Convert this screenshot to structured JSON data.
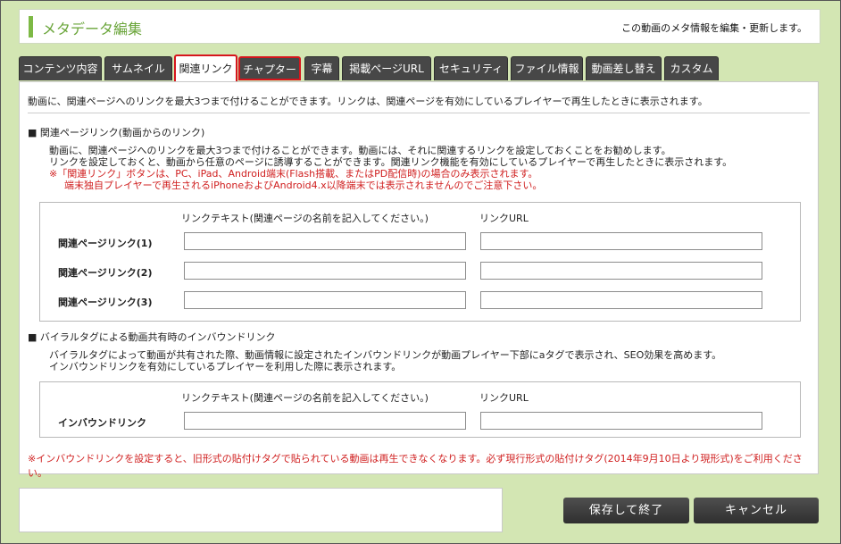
{
  "header": {
    "title": "メタデータ編集",
    "description": "この動画のメタ情報を編集・更新します。"
  },
  "tabs": [
    {
      "label": "コンテンツ内容"
    },
    {
      "label": "サムネイル"
    },
    {
      "label": "関連リンク"
    },
    {
      "label": "チャプター"
    },
    {
      "label": "字幕"
    },
    {
      "label": "掲載ページURL"
    },
    {
      "label": "セキュリティ"
    },
    {
      "label": "ファイル情報"
    },
    {
      "label": "動画差し替え"
    },
    {
      "label": "カスタム"
    }
  ],
  "panel": {
    "intro": "動画に、関連ページへのリンクを最大3つまで付けることができます。リンクは、関連ページを有効にしているプレイヤーで再生したときに表示されます。",
    "related": {
      "title": "■ 関連ページリンク(動画からのリンク)",
      "desc1": "動画に、関連ページへのリンクを最大3つまで付けることができます。動画には、それに関連するリンクを設定しておくことをお勧めします。",
      "desc2": "リンクを設定しておくと、動画から任意のページに誘導することができます。関連リンク機能を有効にしているプレイヤーで再生したときに表示されます。",
      "warn1": "※「関連リンク」ボタンは、PC、iPad、Android端末(Flash搭載、またはPD配信時)の場合のみ表示されます。",
      "warn2": "端末独自プレイヤーで再生されるiPhoneおよびAndroid4.x以降端末では表示されませんのでご注意下さい。",
      "col_text": "リンクテキスト(関連ページの名前を記入してください。)",
      "col_url": "リンクURL",
      "rows": [
        {
          "label": "関連ページリンク(1)",
          "text": "",
          "url": ""
        },
        {
          "label": "関連ページリンク(2)",
          "text": "",
          "url": ""
        },
        {
          "label": "関連ページリンク(3)",
          "text": "",
          "url": ""
        }
      ]
    },
    "inbound": {
      "title": "■ バイラルタグによる動画共有時のインバウンドリンク",
      "desc1": "バイラルタグによって動画が共有された際、動画情報に設定されたインバウンドリンクが動画プレイヤー下部にaタグで表示され、SEO効果を高めます。",
      "desc2": "インバウンドリンクを有効にしているプレイヤーを利用した際に表示されます。",
      "col_text": "リンクテキスト(関連ページの名前を記入してください。)",
      "col_url": "リンクURL",
      "row_label": "インバウンドリンク"
    },
    "footnote": "※インバウンドリンクを設定すると、旧形式の貼付けタグで貼られている動画は再生できなくなります。必ず現行形式の貼付けタグ(2014年9月10日より現形式)をご利用ください。"
  },
  "buttons": {
    "save": "保存して終了",
    "cancel": "キャンセル"
  },
  "colors": {
    "accent_green": "#7db945",
    "tab_dark": "#474747",
    "highlight_red": "#d6161d",
    "warning_red": "#d02020"
  }
}
